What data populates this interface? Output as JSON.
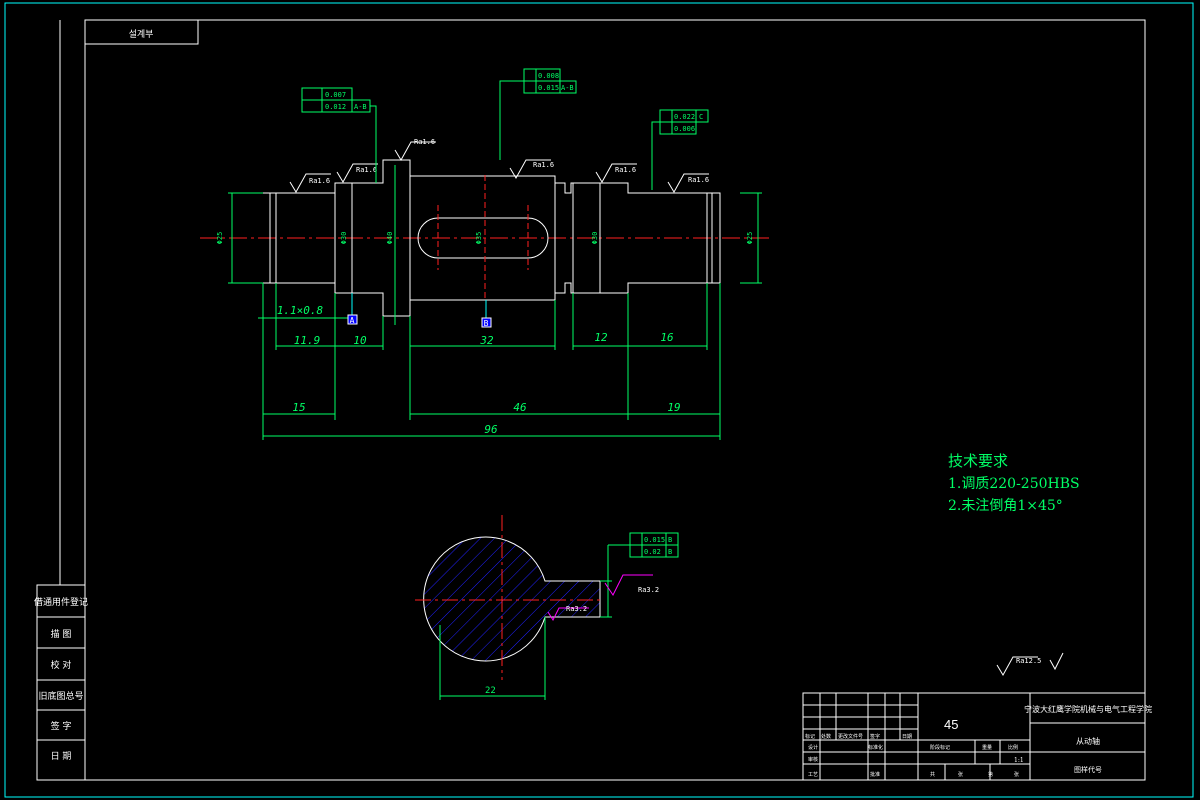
{
  "header": {
    "title_box": "설계부"
  },
  "notes": {
    "heading": "技术要求",
    "line1": "1.调质220-250HBS",
    "line2": "2.未注倒角1×45°"
  },
  "dimensions": {
    "chamfer": "1.1×0.8",
    "d_11_9": "11.9",
    "d_10": "10",
    "d_32": "32",
    "d_12": "12",
    "d_16": "16",
    "d_15": "15",
    "d_46": "46",
    "d_19": "19",
    "d_96": "96",
    "d_section": "22"
  },
  "datums": {
    "a": "A",
    "b": "B"
  },
  "diameters": {
    "left_end": "Φ25",
    "left_shoulder": "Φ30",
    "collar": "Φ40",
    "middle": "Φ35",
    "right_shoulder": "Φ30",
    "right_end": "Φ25"
  },
  "roughness": {
    "r1": "Ra1.6",
    "r2": "Ra1.6",
    "r3": "Ra1.6",
    "r4": "Ra1.6",
    "r5": "Ra1.6",
    "r6": "Ra1.6",
    "r7": "Ra3.2",
    "r8": "Ra3.2",
    "general": "Ra12.5"
  },
  "tolerances": {
    "left_top": {
      "value": "0.007"
    },
    "left_bottom": {
      "value": "0.012",
      "ref": "A-B"
    },
    "mid_top": {
      "value": "0.008"
    },
    "mid_bottom": {
      "value": "0.015",
      "ref": "A-B"
    },
    "right_top": {
      "value": "0.022",
      "ref": "C"
    },
    "right_bottom": {
      "value": "0.006"
    },
    "sec_top": {
      "value": "0.015",
      "ref": "B"
    },
    "sec_bottom": {
      "value": "0.02",
      "ref": "B"
    }
  },
  "left_table": {
    "rows": [
      "借通用件登记",
      "描 图",
      "校 对",
      "旧底图总号",
      "签 字",
      "日 期"
    ]
  },
  "title_block": {
    "material": "45",
    "school": "宁波大红鹰学院机械与电气工程学院",
    "part_name": "从动轴",
    "drawing_no": "图样代号",
    "scale": "1:1",
    "cells": [
      "标记",
      "处数",
      "更改文件号",
      "签字",
      "日期",
      "设计",
      "标准化",
      "审核",
      "工艺",
      "批准",
      "阶段标记",
      "重量",
      "比例",
      "共",
      "张",
      "第",
      "张"
    ]
  }
}
